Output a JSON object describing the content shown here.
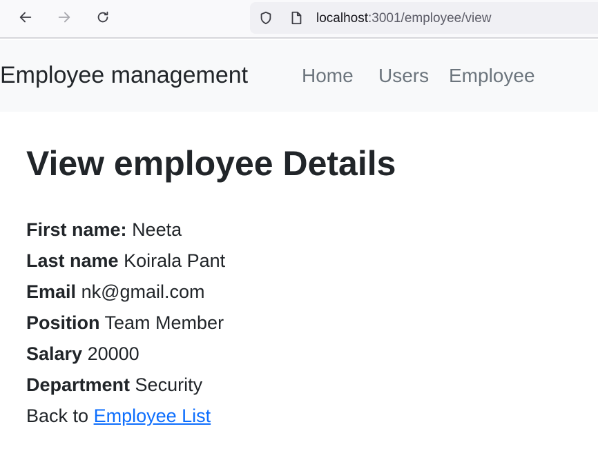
{
  "browser": {
    "url_host": "localhost",
    "url_rest": ":3001/employee/view"
  },
  "navbar": {
    "brand": "Employee management",
    "links": [
      "Home",
      "Users",
      "Employee"
    ]
  },
  "page": {
    "title": "View employee Details",
    "fields": [
      {
        "label": "First name:",
        "value": "Neeta"
      },
      {
        "label": "Last name",
        "value": "Koirala Pant"
      },
      {
        "label": "Email",
        "value": "nk@gmail.com"
      },
      {
        "label": "Position",
        "value": "Team Member"
      },
      {
        "label": "Salary",
        "value": "20000"
      },
      {
        "label": "Department",
        "value": "Security"
      }
    ],
    "back_prefix": "Back to",
    "back_link": "Employee List"
  },
  "colors": {
    "link": "#0d6efd",
    "nav_link": "#6c757d",
    "navbar_bg": "#f8f9fa"
  }
}
